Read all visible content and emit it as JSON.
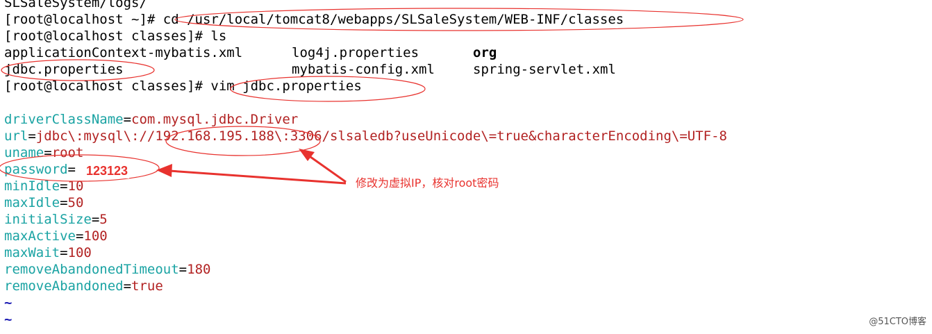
{
  "terminal": {
    "lines": {
      "l0": "SLSaleSystem/logs/",
      "l1_prompt": "[root@localhost ~]#",
      "l1_cmd": " cd /usr/local/tomcat8/webapps/SLSaleSystem/WEB-INF/classes",
      "l2": "[root@localhost classes]# ls",
      "ls_files": {
        "f1": "applicationContext-mybatis.xml",
        "f2": "log4j.properties",
        "f3": "org",
        "f4": "jdbc.properties",
        "f5": "mybatis-config.xml",
        "f6": "spring-servlet.xml"
      },
      "l5_prompt": "[root@localhost classes]#",
      "l5_cmd": " vim jdbc.properties"
    },
    "props": [
      {
        "key": "driverClassName",
        "value": "com.mysql.jdbc.Driver"
      },
      {
        "key": "url",
        "value": "jdbc\\:mysql\\://192.168.195.188\\:3306/slsaledb?useUnicode\\=true&characterEncoding\\=UTF-8"
      },
      {
        "key": "uname",
        "value": "root"
      },
      {
        "key": "password",
        "value": ""
      },
      {
        "key": "minIdle",
        "value": "10"
      },
      {
        "key": "maxIdle",
        "value": "50"
      },
      {
        "key": "initialSize",
        "value": "5"
      },
      {
        "key": "maxActive",
        "value": "100"
      },
      {
        "key": "maxWait",
        "value": "100"
      },
      {
        "key": "removeAbandonedTimeout",
        "value": "180"
      },
      {
        "key": "removeAbandoned",
        "value": "true"
      }
    ],
    "eq": "=",
    "tilde": "~"
  },
  "annotations": {
    "password_overlay": "123123",
    "note": "修改为虚拟IP，核对root密码",
    "color": "#e8322e"
  },
  "watermark": "@51CTO博客"
}
